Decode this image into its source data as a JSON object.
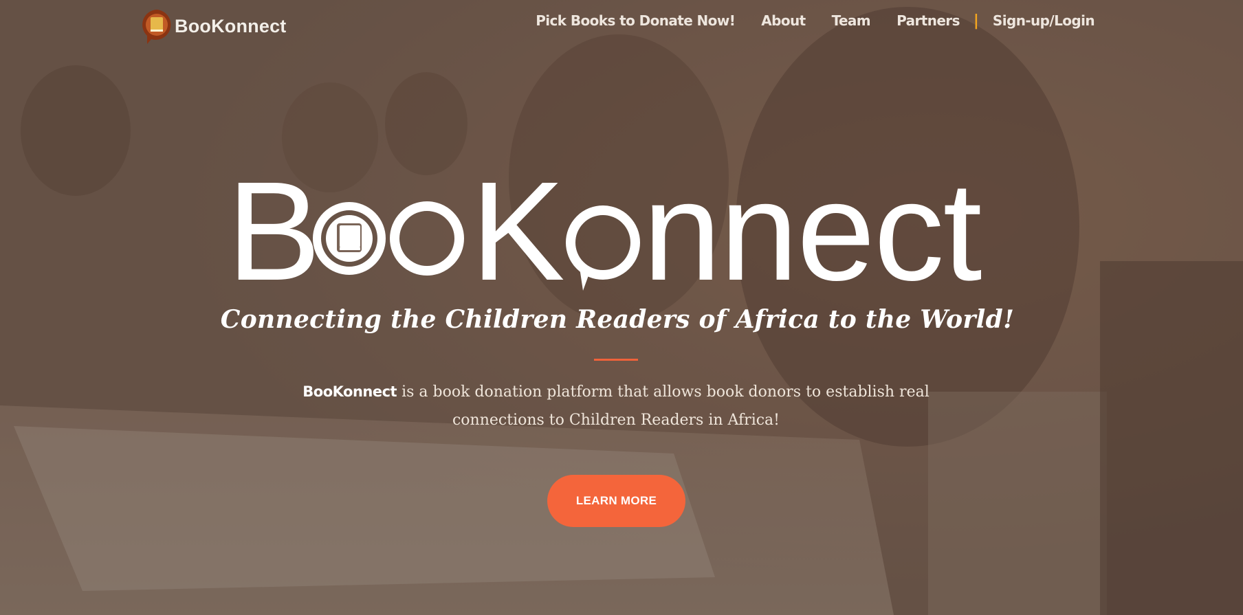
{
  "nav": {
    "brand": "BooKonnect",
    "links": {
      "pick_books": "Pick Books to Donate Now!",
      "about": "About",
      "team": "Team",
      "partners": "Partners",
      "separator": "|",
      "signup_login": "Sign-up/Login"
    }
  },
  "hero": {
    "logo_text": "BooKonnect",
    "tagline": "Connecting the Children Readers of Africa to the World!",
    "description_brand": "BooKonnect",
    "description_text": " is a book donation platform that allows book donors to establish real connections to Children Readers in Africa!",
    "cta_label": "LEARN MORE"
  },
  "colors": {
    "accent": "#f4653b",
    "nav_separator": "#f4a61f",
    "logo_ring": "#8b3412",
    "logo_book": "#e6b84a"
  },
  "icons": {
    "brand_logo": "book-speech-bubble-icon",
    "hero_logo_o": "book-in-circle-icon"
  }
}
